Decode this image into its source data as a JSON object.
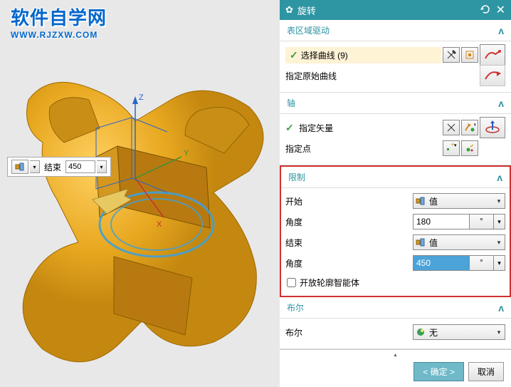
{
  "watermark": {
    "main": "软件自学网",
    "sub": "WWW.RJZXW.COM"
  },
  "float": {
    "end_label": "结束",
    "end_value": "450"
  },
  "panel": {
    "title": "旋转",
    "sec_region": {
      "title": "表区域驱动",
      "select_curve": "选择曲线 (9)",
      "orig_curve": "指定原始曲线"
    },
    "sec_axis": {
      "title": "轴",
      "vector": "指定矢量",
      "point": "指定点"
    },
    "sec_limit": {
      "title": "限制",
      "start_lbl": "开始",
      "start_val": "值",
      "angle1_lbl": "角度",
      "angle1_val": "180",
      "angle_unit": "°",
      "end_lbl": "结束",
      "end_val": "值",
      "angle2_lbl": "角度",
      "angle2_val": "450",
      "open_body": "开放轮廓智能体"
    },
    "sec_bool": {
      "title": "布尔",
      "label": "布尔",
      "value": "无"
    },
    "ok": "< 确定 >",
    "cancel": "取消"
  },
  "chart_data": {
    "type": "3d-revolve",
    "axis_labels": [
      "X",
      "Y",
      "Z"
    ],
    "revolve_start_angle": 180,
    "revolve_end_angle": 450
  }
}
